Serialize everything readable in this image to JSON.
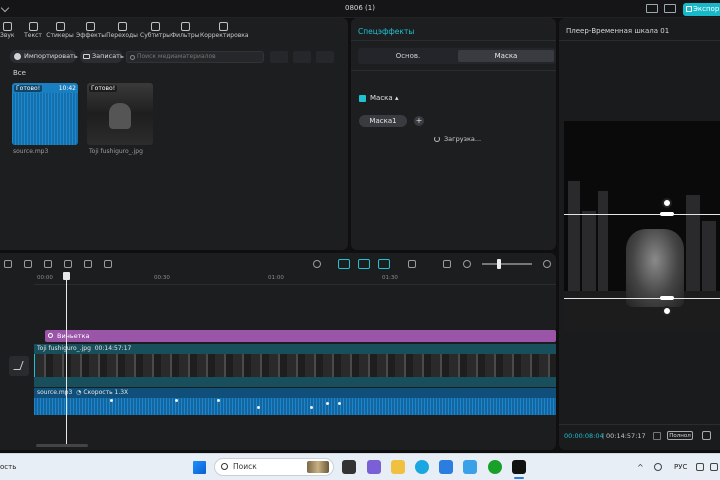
{
  "window": {
    "title": "0806 (1)",
    "export_label": "Экспор"
  },
  "toolbar": {
    "items": [
      {
        "label": "Звук",
        "icon": "sound-icon"
      },
      {
        "label": "Текст",
        "icon": "text-icon"
      },
      {
        "label": "Стикеры",
        "icon": "sticker-icon"
      },
      {
        "label": "Эффекты",
        "icon": "effects-icon"
      },
      {
        "label": "Переходы",
        "icon": "transitions-icon"
      },
      {
        "label": "Субтитры",
        "icon": "subtitles-icon"
      },
      {
        "label": "Фильтры",
        "icon": "filters-icon"
      },
      {
        "label": "Корректировка",
        "icon": "adjust-icon"
      }
    ]
  },
  "media": {
    "import_label": "Импортировать",
    "record_label": "Записать",
    "search_placeholder": "Поиск медиаматериалов",
    "section_label": "Все",
    "items": [
      {
        "name": "source.mp3",
        "status": "Готово!",
        "duration": "10:42"
      },
      {
        "name": "Toji fushiguro_.jpg",
        "status": "Готово!"
      }
    ]
  },
  "effects": {
    "title": "Спецэффекты",
    "tabs": [
      "Основ.",
      "Маска"
    ],
    "active_tab": "Маска",
    "mask_section_label": "Маска",
    "mask_item_label": "Маска1",
    "add_symbol": "+",
    "loading_label": "Загрузка..."
  },
  "player": {
    "title": "Плеер-Временная шкала 01",
    "current_time": "00:00:08:04",
    "total_time": "00:14:57:17",
    "full_label": "Полнол"
  },
  "timeline": {
    "ruler_ticks": [
      "00:00",
      "00:30",
      "01:00",
      "01:30"
    ],
    "vignette_label": "Виньетка",
    "video_clip_name": "Toji fushiguro_.jpg",
    "video_clip_duration": "00:14:57:17",
    "audio_clip_name": "source.mp3",
    "audio_speed_label": "Скорость 1.3X"
  },
  "taskbar": {
    "left_text": "ость",
    "search_placeholder": "Поиск",
    "language": "РУС"
  },
  "colors": {
    "accent": "#1fc1d3",
    "vignette": "#9a55a8",
    "audio": "#1a86cf",
    "video": "#17505c"
  }
}
